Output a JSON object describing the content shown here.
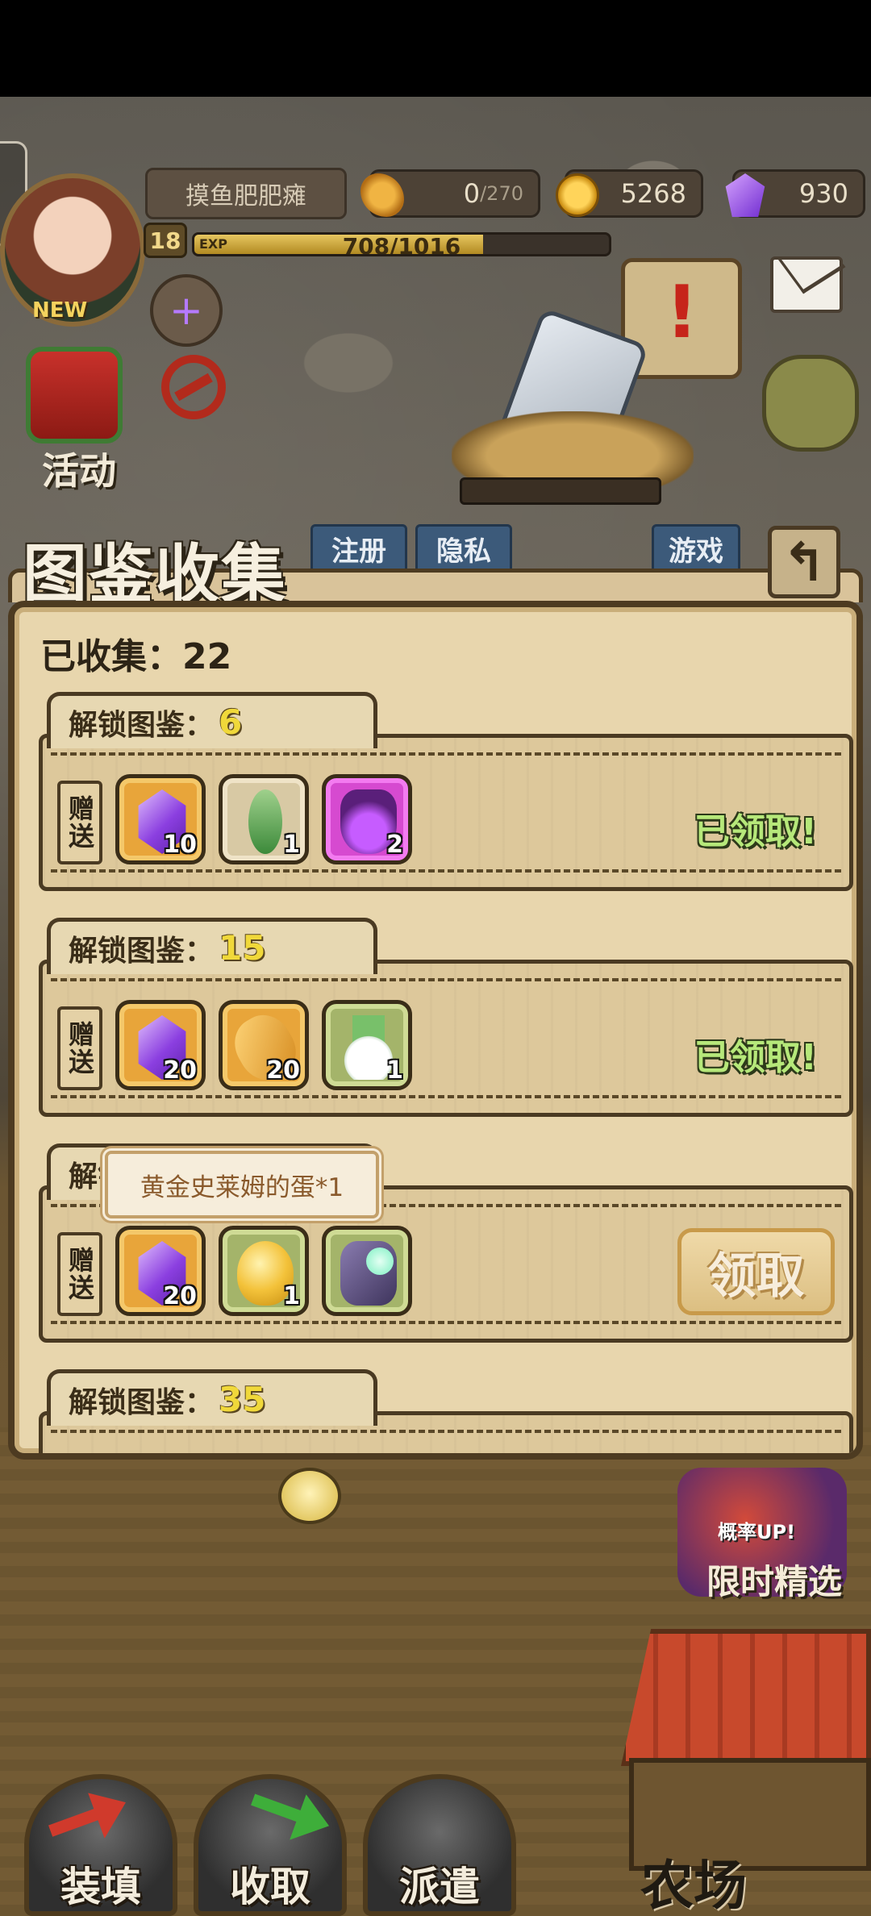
{
  "hud": {
    "player_name": "摸鱼肥肥瘫",
    "new_tag": "NEW",
    "level": "18",
    "exp_label": "EXP",
    "exp_text": "708/1016",
    "exp_progress": 0.697,
    "bread_value": "0",
    "bread_max": "/270",
    "gold": "5268",
    "gems": "930",
    "event_label": "活动"
  },
  "menu_tabs": [
    "注册",
    "隐私",
    "游戏"
  ],
  "panel": {
    "title": "图鉴收集",
    "back_symbol": "↰",
    "collected_label": "已收集：22",
    "gift_label": "赠送",
    "sections": [
      {
        "label": "解锁图鉴：",
        "threshold": "6",
        "status": "已领取!",
        "items": [
          {
            "icon": "purple-gem-icon",
            "frame": "orange",
            "count": "10"
          },
          {
            "icon": "green-leaf-icon",
            "frame": "cream",
            "count": "1"
          },
          {
            "icon": "purple-potion-icon",
            "frame": "pink",
            "count": "2"
          }
        ]
      },
      {
        "label": "解锁图鉴：",
        "threshold": "15",
        "status": "已领取!",
        "items": [
          {
            "icon": "purple-gem-icon",
            "frame": "orange",
            "count": "20"
          },
          {
            "icon": "bread-icon",
            "frame": "orange",
            "count": "20"
          },
          {
            "icon": "radish-icon",
            "frame": "green",
            "count": "1"
          }
        ]
      },
      {
        "label": "解锁图鉴：",
        "threshold": "",
        "claim_button": "领取",
        "items": [
          {
            "icon": "purple-gem-icon",
            "frame": "orange",
            "count": "20"
          },
          {
            "icon": "golden-slime-egg-icon",
            "frame": "green",
            "count": "1"
          },
          {
            "icon": "glove-orb-icon",
            "frame": "green",
            "count": ""
          }
        ]
      },
      {
        "label": "解锁图鉴：",
        "threshold": "35"
      }
    ],
    "tooltip": "黄金史莱姆的蛋*1"
  },
  "scene": {
    "limited_badge": "概率UP!",
    "limited_label": "限时精选",
    "farm_label": "农场"
  },
  "bottom_buttons": [
    "装填",
    "收取",
    "派遣"
  ],
  "colors": {
    "accent_yellow": "#f0d83a",
    "claimed_green": "#b6e87a",
    "panel_bg": "#e8d6ad",
    "panel_border": "#4d3b21"
  }
}
